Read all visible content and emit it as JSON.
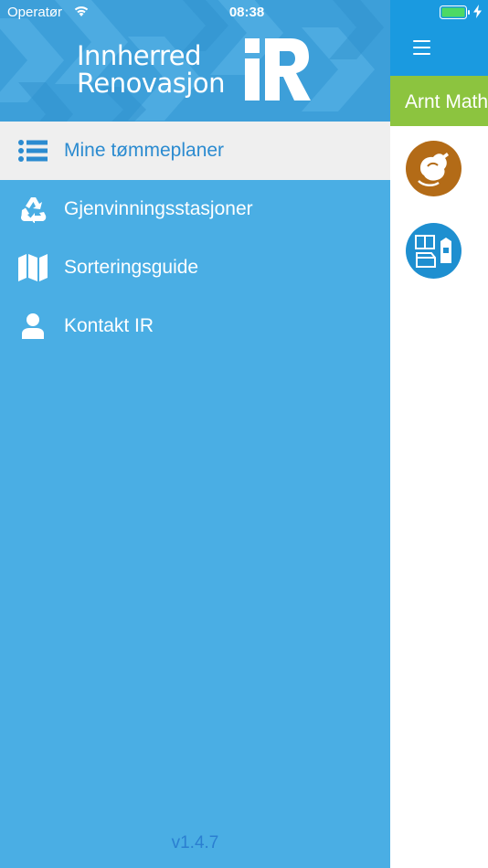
{
  "status_bar": {
    "carrier": "Operatør",
    "time": "08:38"
  },
  "drawer": {
    "logo": {
      "line1": "Innherred",
      "line2": "Renovasjon"
    },
    "menu": [
      {
        "label": "Mine tømmeplaner",
        "icon": "list-icon",
        "active": true
      },
      {
        "label": "Gjenvinningsstasjoner",
        "icon": "recycle-icon",
        "active": false
      },
      {
        "label": "Sorteringsguide",
        "icon": "map-icon",
        "active": false
      },
      {
        "label": "Kontakt IR",
        "icon": "person-icon",
        "active": false
      }
    ],
    "version": "v1.4.7"
  },
  "main": {
    "address": "Arnt Math",
    "bins": [
      {
        "type": "food-waste-icon",
        "color": "#b36b17"
      },
      {
        "type": "paper-cardboard-icon",
        "color": "#1e8fd0"
      }
    ]
  },
  "colors": {
    "drawer_bg": "#4aaee4",
    "header_bg": "#3d9fd9",
    "active_item_bg": "#efefef",
    "active_text": "#2b8bd0",
    "nav_blue": "#1a9ae0",
    "address_green": "#8cc43f"
  }
}
